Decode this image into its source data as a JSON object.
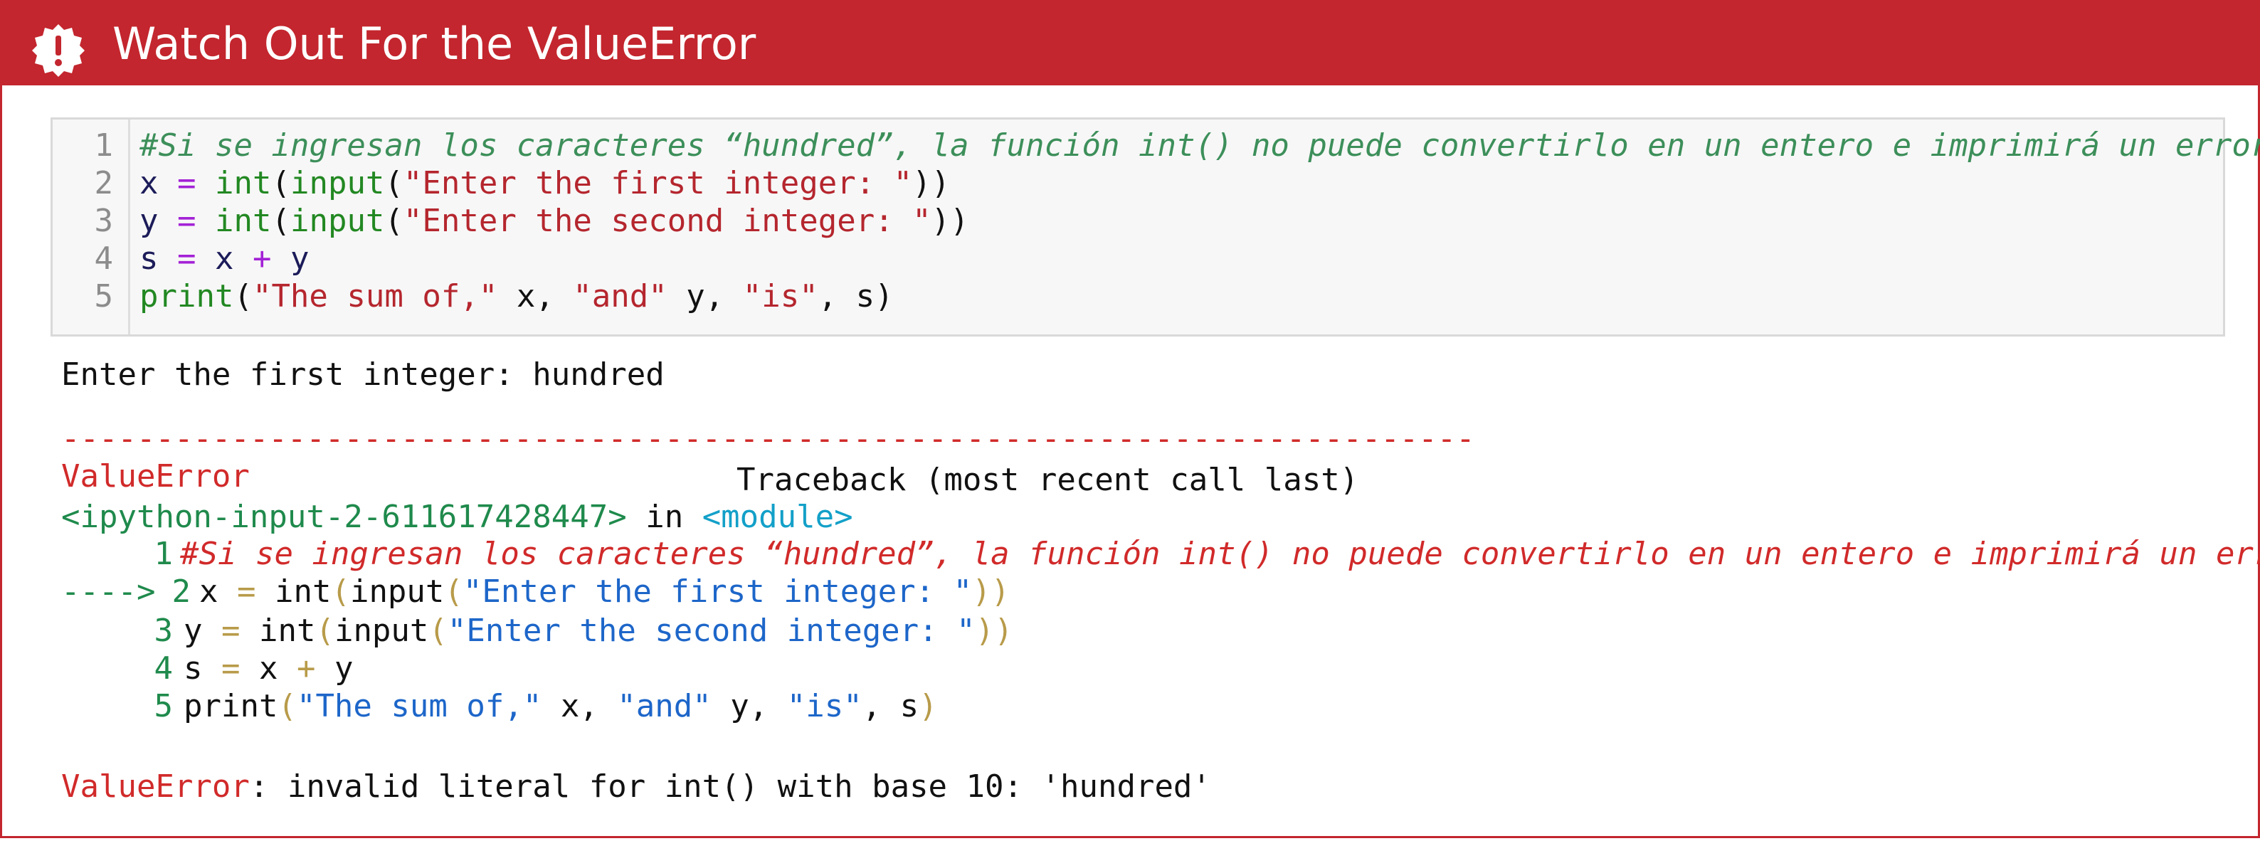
{
  "header": {
    "title": "Watch Out For the ValueError",
    "icon": "warning-badge-icon",
    "background": "#c3262e"
  },
  "code_cell": {
    "line_numbers": [
      "1",
      "2",
      "3",
      "4",
      "5"
    ],
    "comment": "#Si se ingresan los caracteres “hundred”, la función int() no puede convertirlo en un entero e imprimirá un error.",
    "line2": {
      "var": "x",
      "eq": " = ",
      "int": "int",
      "paren1": "(",
      "input": "input",
      "paren2": "(",
      "prompt": "\"Enter the first integer: \"",
      "close": "))"
    },
    "line3": {
      "var": "y",
      "eq": " = ",
      "int": "int",
      "paren1": "(",
      "input": "input",
      "paren2": "(",
      "prompt": "\"Enter the second integer: \"",
      "close": "))"
    },
    "line4": {
      "s": "s",
      "eq": " = ",
      "x": "x",
      "plus": " + ",
      "y": "y"
    },
    "line5": {
      "print": "print",
      "open": "(",
      "s1": "\"The sum of,\"",
      "a1": " x, ",
      "s2": "\"and\"",
      "a2": " y, ",
      "s3": "\"is\"",
      "a3": ", s)"
    }
  },
  "output": {
    "prompt_line": "Enter the first integer: hundred",
    "separator": "---------------------------------------------------------------------------",
    "error_name": "ValueError",
    "traceback_title": "Traceback (most recent call last)",
    "location": {
      "input_ref": "<ipython-input-2-611617428447>",
      "in_word": " in ",
      "module": "<module>"
    },
    "arrow": "---->",
    "tb_numbers": [
      "1",
      "2",
      "3",
      "4",
      "5"
    ],
    "tb_comment": "#Si se ingresan los caracteres “hundred”, la función int() no puede convertirlo en un entero e imprimirá un error.",
    "tb_line2": {
      "a": "x ",
      "eq": "=",
      "b": " int",
      "p1": "(",
      "input": "input",
      "p2": "(",
      "str": "\"Enter the first integer: \"",
      "close": "))"
    },
    "tb_line3": {
      "a": "y ",
      "eq": "=",
      "b": " int",
      "p1": "(",
      "input": "input",
      "p2": "(",
      "str": "\"Enter the second integer: \"",
      "close": "))"
    },
    "tb_line4": {
      "a": "s ",
      "eq": "=",
      "b": " x ",
      "plus": "+",
      "c": " y"
    },
    "tb_line5": {
      "print": "print",
      "p1": "(",
      "s1": "\"The sum of,\"",
      "a1": " x, ",
      "s2": "\"and\"",
      "a2": " y, ",
      "s3": "\"is\"",
      "a3": ", s",
      "p2": ")"
    },
    "final_error_name": "ValueError",
    "final_error_msg": ": invalid literal for int() with base 10: 'hundred'"
  }
}
